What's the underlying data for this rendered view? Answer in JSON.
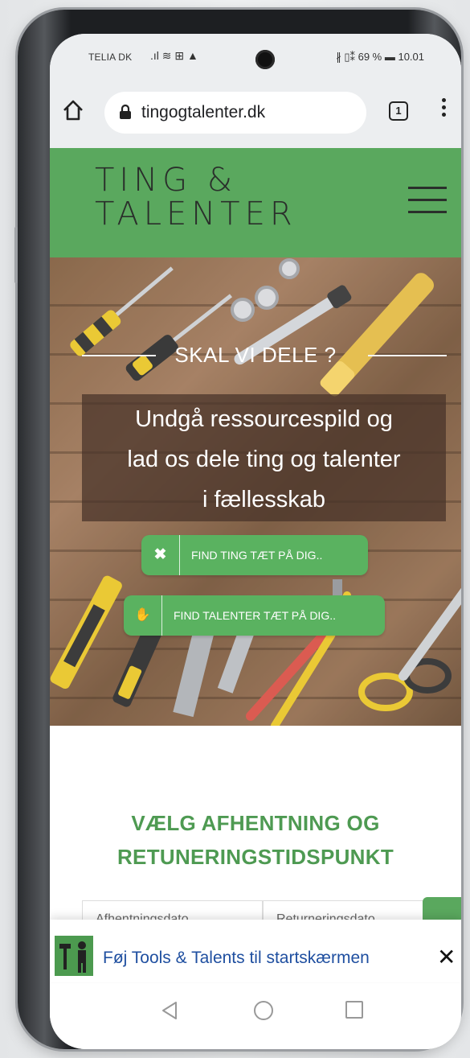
{
  "status_bar": {
    "carrier": "TELIA DK",
    "status_icons": ".ıl ≋ ⊞ ▲",
    "right_status": "∦ ▯⁑ 69 % ▬ 10.01",
    "battery_percent": 69,
    "time": "10.01"
  },
  "browser": {
    "url": "tingogtalenter.dk",
    "tab_count": "1",
    "icons": [
      "home-icon",
      "lock-icon",
      "tabs-icon",
      "overflow-menu-icon"
    ]
  },
  "site_header": {
    "logo_line1": "TING &",
    "logo_line2": "TALENTER",
    "background_color": "#5aa85e",
    "menu_icon": "hamburger-icon"
  },
  "hero": {
    "kicker": "SKAL VI DELE ?",
    "headline": "Undgå ressourcespild og lad os dele ting og talenter i fællesskab",
    "headline_lines": [
      "Undgå ressourcespild og",
      "lad os dele ting og talenter",
      "i fællesskab"
    ],
    "button_things": {
      "label": "FIND TING TÆT PÅ DIG..",
      "icon": "tools-icon",
      "glyph": "✖"
    },
    "button_talents": {
      "label": "FIND TALENTER TÆT PÅ DIG..",
      "icon": "handshake-icon",
      "glyph": "✋"
    },
    "button_color": "#5ab260"
  },
  "booking": {
    "title_line1": "VÆLG AFHENTNING OG",
    "title_line2": "RETUNERINGSTIDSPUNKT",
    "title_color": "#4e9a52",
    "pickup_placeholder": "Afhentningsdato",
    "return_placeholder": "Returneringsdato"
  },
  "add_to_homescreen": {
    "text": "Føj Tools & Talents til startskærmen",
    "close_glyph": "✕"
  },
  "nav_bar": {
    "icons": [
      "back-icon",
      "home-icon",
      "recent-apps-icon"
    ]
  }
}
